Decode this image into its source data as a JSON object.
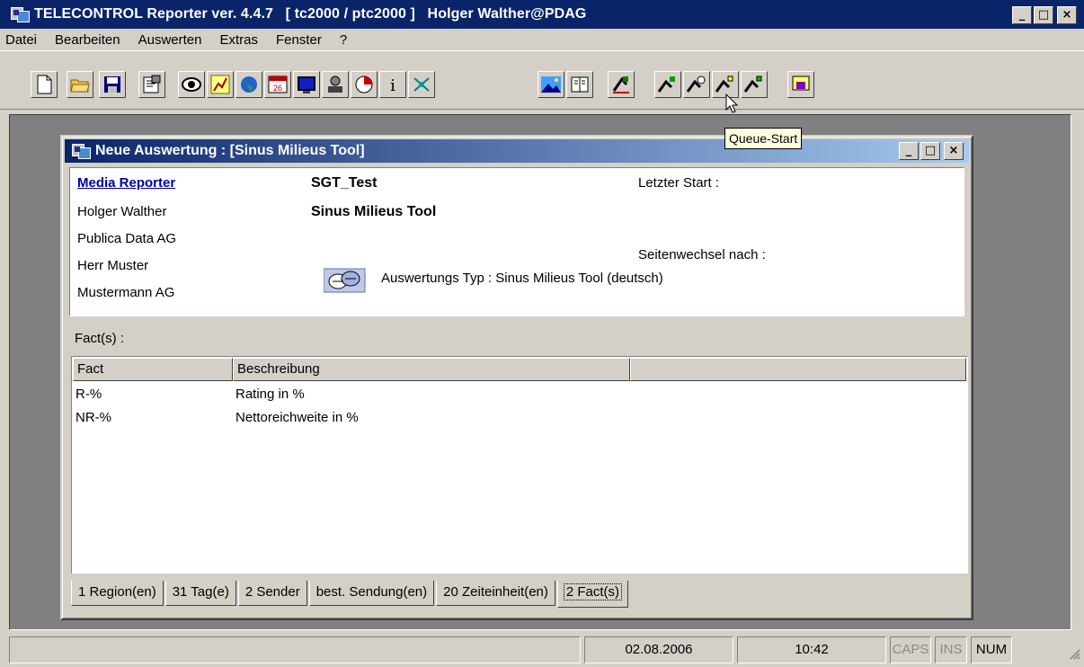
{
  "window": {
    "title": "TELECONTROL Reporter ver. 4.4.7   [ tc2000 / ptc2000 ]   Holger Walther@PDAG",
    "minimize": "_",
    "maximize": "□",
    "close": "×"
  },
  "menu": [
    "Datei",
    "Bearbeiten",
    "Auswerten",
    "Extras",
    "Fenster",
    "?"
  ],
  "toolbar": {
    "tooltip": "Queue-Start",
    "calendar_day": "26",
    "info_glyph": "i"
  },
  "child": {
    "title": "Neue Auswertung : [Sinus Milieus Tool]",
    "left": [
      "Media Reporter",
      "Holger Walther",
      "Publica Data AG",
      "Herr Muster",
      "Mustermann AG"
    ],
    "name": "SGT_Test",
    "tool": "Sinus Milieus Tool",
    "last_start_label": "Letzter Start :",
    "page_break_label": "Seitenwechsel nach :",
    "type_label": "Auswertungs Typ : Sinus Milieus Tool (deutsch)",
    "facts_label": "Fact(s) :",
    "columns": [
      "Fact",
      "Beschreibung",
      ""
    ],
    "rows": [
      {
        "fact": "R-%",
        "desc": "Rating in %"
      },
      {
        "fact": "NR-%",
        "desc": "Nettoreichweite in %"
      }
    ],
    "tabs": [
      "1  Region(en)",
      "31  Tag(e)",
      "2  Sender",
      "best. Sendung(en)",
      "20  Zeiteinheit(en)",
      "2  Fact(s)"
    ],
    "active_tab": 5
  },
  "status": {
    "date": "02.08.2006",
    "time": "10:42",
    "caps": "CAPS",
    "ins": "INS",
    "num": "NUM"
  }
}
